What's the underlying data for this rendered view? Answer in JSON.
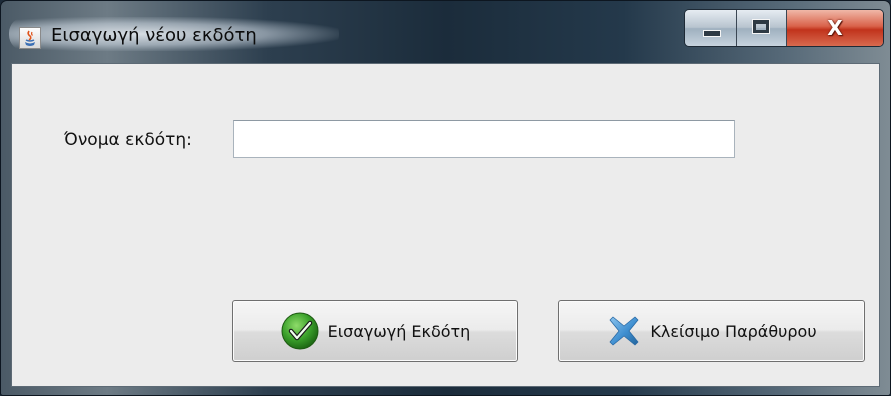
{
  "window": {
    "title": "Εισαγωγή νέου εκδότη"
  },
  "icons": {
    "app": "java-cup-icon",
    "minimize": "minimize-icon",
    "maximize": "maximize-icon",
    "close": "close-icon",
    "insert_button_icon": "green-check-icon",
    "close_button_icon": "blue-x-icon"
  },
  "form": {
    "publisher_label": "Όνομα εκδότη:",
    "publisher_value": "",
    "publisher_placeholder": ""
  },
  "buttons": {
    "insert_label": "Εισαγωγή Εκδότη",
    "close_label": "Κλείσιμο Παράθυρου"
  },
  "colors": {
    "check_green": "#3aa02a",
    "x_blue": "#3f8fd0",
    "close_red": "#c1331c"
  }
}
